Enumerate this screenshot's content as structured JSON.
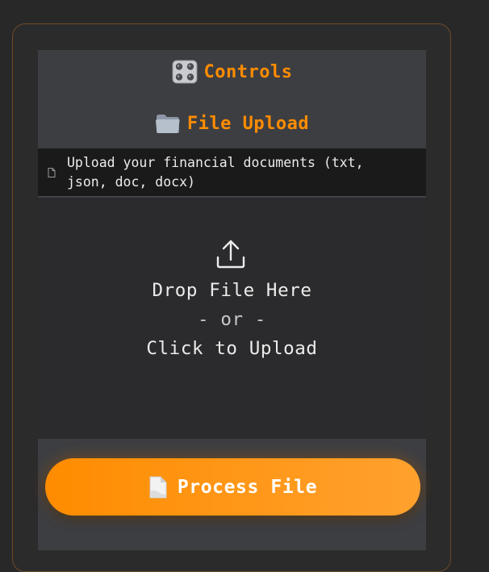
{
  "controls": {
    "title": "Controls",
    "icon": "control-knobs-icon"
  },
  "file_upload": {
    "title": "File Upload",
    "icon": "folder-icon",
    "file_types_label": "Upload your financial documents (txt,\njson, doc, docx)",
    "file_types_icon": "document-icon"
  },
  "dropzone": {
    "icon": "upload-icon",
    "line1": "Drop File Here",
    "line2": "- or -",
    "line3": "Click to Upload"
  },
  "process_button": {
    "label": "Process File",
    "icon": "page-icon"
  },
  "colors": {
    "accent": "#ff8c00",
    "background": "#282828",
    "panel": "#3d3e42",
    "dropzone": "#2b2b2d"
  }
}
